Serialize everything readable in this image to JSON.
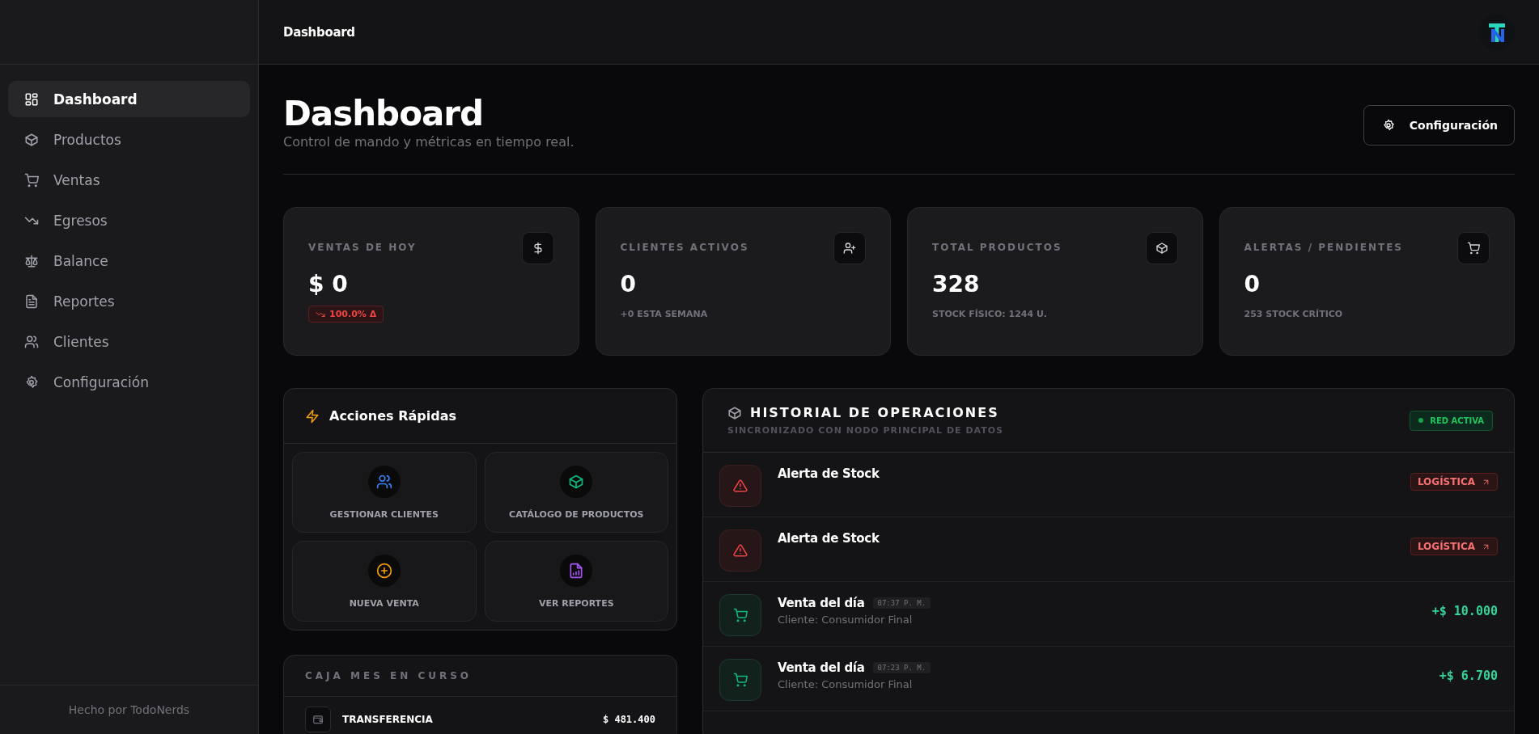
{
  "sidebar": {
    "items": [
      {
        "label": "Dashboard",
        "selected": true
      },
      {
        "label": "Productos",
        "selected": false
      },
      {
        "label": "Ventas",
        "selected": false
      },
      {
        "label": "Egresos",
        "selected": false
      },
      {
        "label": "Balance",
        "selected": false
      },
      {
        "label": "Reportes",
        "selected": false
      },
      {
        "label": "Clientes",
        "selected": false
      },
      {
        "label": "Configuración",
        "selected": false
      }
    ],
    "footer": "Hecho por TodoNerds"
  },
  "header": {
    "title": "Dashboard"
  },
  "page": {
    "title": "Dashboard",
    "subtitle": "Control de mando y métricas en tiempo real.",
    "settings_button": "Configuración"
  },
  "stats": [
    {
      "label": "VENTAS DE HOY",
      "value": "$ 0",
      "kind": "trend",
      "trend": "100.0% Δ"
    },
    {
      "label": "CLIENTES ACTIVOS",
      "value": "0",
      "kind": "note",
      "note": "+0 ESTA SEMANA"
    },
    {
      "label": "TOTAL PRODUCTOS",
      "value": "328",
      "kind": "note",
      "note": "STOCK FÍSICO: 1244 U."
    },
    {
      "label": "ALERTAS / PENDIENTES",
      "value": "0",
      "kind": "note",
      "note": "253 STOCK CRÍTICO"
    }
  ],
  "quick_actions": {
    "title": "Acciones Rápidas",
    "items": [
      {
        "label": "GESTIONAR CLIENTES"
      },
      {
        "label": "CATÁLOGO DE PRODUCTOS"
      },
      {
        "label": "NUEVA VENTA"
      },
      {
        "label": "VER REPORTES"
      }
    ]
  },
  "cash": {
    "title": "CAJA MES EN CURSO",
    "rows": [
      {
        "label": "TRANSFERENCIA",
        "amount": "$ 481.400"
      }
    ]
  },
  "history": {
    "title": "HISTORIAL DE OPERACIONES",
    "subtitle": "SINCRONIZADO CON NODO PRINCIPAL DE DATOS",
    "status": "RED ACTIVA",
    "rows": [
      {
        "kind": "alert",
        "title": "Alerta de Stock",
        "tag": "LOGÍSTICA"
      },
      {
        "kind": "alert",
        "title": "Alerta de Stock",
        "tag": "LOGÍSTICA"
      },
      {
        "kind": "sale",
        "title": "Venta del día",
        "time": "07:37 P. M.",
        "client": "Cliente: Consumidor Final",
        "amount": "+$ 10.000"
      },
      {
        "kind": "sale",
        "title": "Venta del día",
        "time": "07:23 P. M.",
        "client": "Cliente: Consumidor Final",
        "amount": "+$ 6.700"
      }
    ]
  }
}
